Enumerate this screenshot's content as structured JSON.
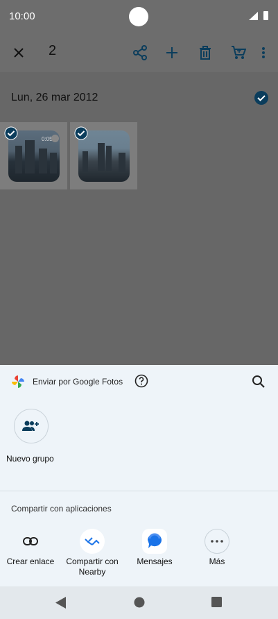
{
  "status_bar": {
    "time": "10:00"
  },
  "action_bar": {
    "selected_count": "2"
  },
  "gallery": {
    "date_label": "Lun, 26 mar 2012",
    "items": [
      {
        "type": "video",
        "duration": "0:05",
        "selected": true
      },
      {
        "type": "photo",
        "selected": true
      }
    ]
  },
  "share_sheet": {
    "title": "Enviar por Google Fotos",
    "new_group_label": "Nuevo grupo",
    "apps_section_title": "Compartir con aplicaciones",
    "apps": [
      {
        "label": "Crear enlace",
        "icon": "link-icon"
      },
      {
        "label": "Compartir con Nearby",
        "icon": "nearby-icon"
      },
      {
        "label": "Mensajes",
        "icon": "messages-icon"
      },
      {
        "label": "Más",
        "icon": "more-horizontal-icon"
      }
    ]
  },
  "colors": {
    "accent": "#0b3d5c",
    "sheet_background": "#eef4f9",
    "scrim": "#6d6d6d"
  }
}
